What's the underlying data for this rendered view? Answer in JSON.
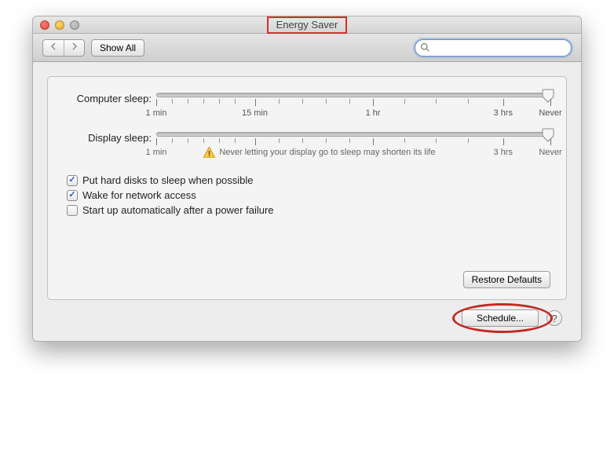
{
  "title": "Energy Saver",
  "toolbar": {
    "show_all": "Show All",
    "search_placeholder": ""
  },
  "sliders": {
    "computer": {
      "label": "Computer sleep:",
      "ticks": {
        "min": "1 min",
        "mid1": "15 min",
        "mid2": "1 hr",
        "max": "3 hrs",
        "never": "Never"
      },
      "value": "Never"
    },
    "display": {
      "label": "Display sleep:",
      "ticks": {
        "min": "1 min",
        "max": "3 hrs",
        "never": "Never"
      },
      "warning": "Never letting your display go to sleep may shorten its life",
      "value": "Never"
    }
  },
  "checks": {
    "hdd": {
      "label": "Put hard disks to sleep when possible",
      "checked": true
    },
    "wake": {
      "label": "Wake for network access",
      "checked": true
    },
    "startup": {
      "label": "Start up automatically after a power failure",
      "checked": false
    }
  },
  "buttons": {
    "restore": "Restore Defaults",
    "schedule": "Schedule...",
    "help": "?"
  }
}
